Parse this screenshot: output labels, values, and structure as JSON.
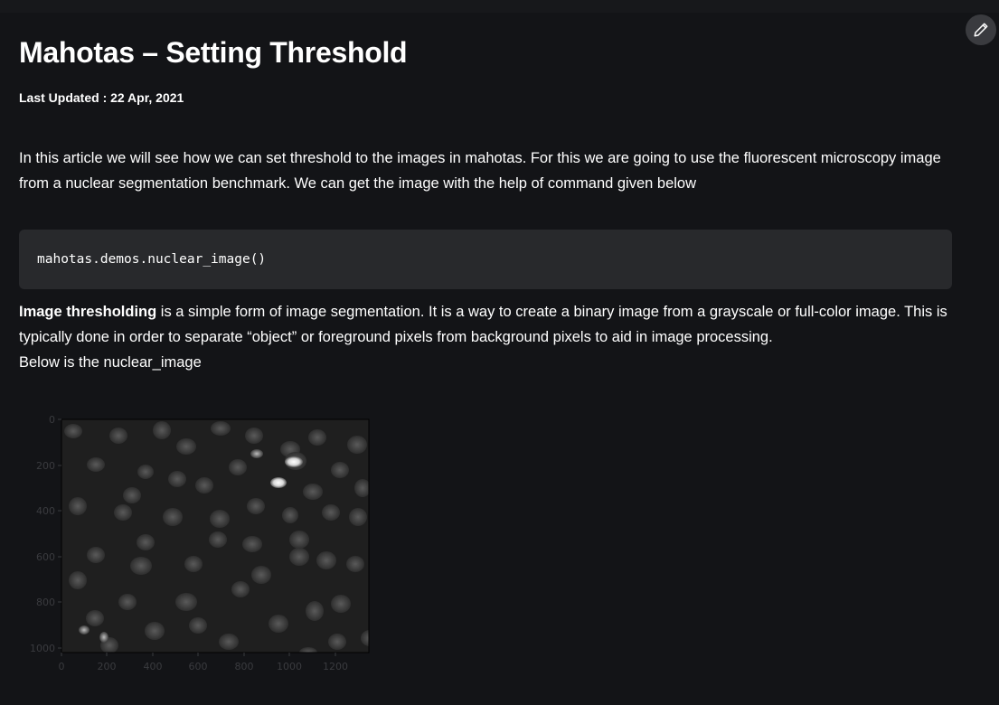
{
  "article": {
    "title": "Mahotas – Setting Threshold",
    "last_updated": "Last Updated : 22 Apr, 2021",
    "intro": "In this article we will see how we can set threshold to the images in mahotas. For this we are going to use the fluorescent microscopy image from a nuclear segmentation benchmark. We can get the image with the help of command given below",
    "code": "mahotas.demos.nuclear_image()",
    "definition_bold": "Image thresholding",
    "definition_text": " is a simple form of image segmentation. It is a way to create a binary image from a grayscale or full-color image. This is typically done in order to separate “object” or foreground pixels from background pixels to aid in image processing.",
    "below_text": "Below is the nuclear_image"
  },
  "edit_button": {
    "icon": "pencil-icon"
  },
  "figure": {
    "x_ticks": [
      "0",
      "200",
      "400",
      "600",
      "800",
      "1000",
      "1200"
    ],
    "y_ticks": [
      "0",
      "200",
      "400",
      "600",
      "800",
      "1000"
    ]
  },
  "colors": {
    "background": "#131417",
    "code_background": "#28292c",
    "text": "#ffffff",
    "edit_button": "#3a3b3f"
  }
}
